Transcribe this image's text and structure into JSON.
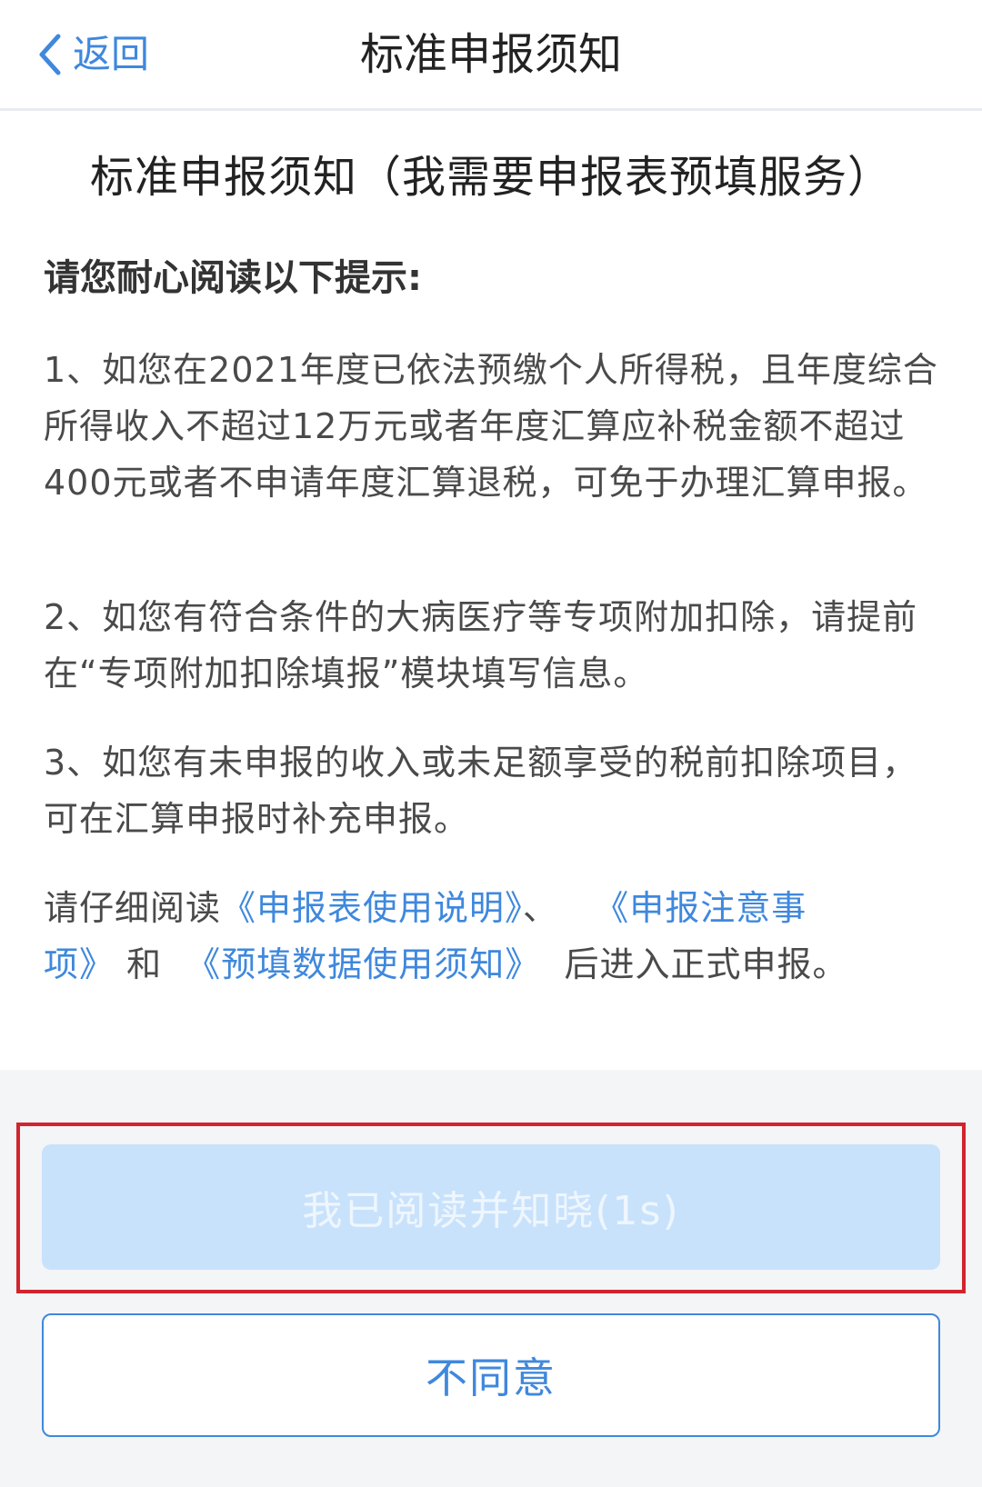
{
  "navbar": {
    "back_label": "返回",
    "title": "标准申报须知"
  },
  "content": {
    "title": "标准申报须知（我需要申报表预填服务）",
    "intro": "请您耐心阅读以下提示:",
    "paragraphs": [
      "1、如您在2021年度已依法预缴个人所得税，且年度综合所得收入不超过12万元或者年度汇算应补税金额不超过400元或者不申请年度汇算退税，可免于办理汇算申报。",
      "2、如您有符合条件的大病医疗等专项附加扣除，请提前在“专项附加扣除填报”模块填写信息。",
      "3、如您有未申报的收入或未足额享受的税前扣除项目，可在汇算申报时补充申报。"
    ],
    "final": {
      "prefix": "请仔细阅读",
      "link1": "《申报表使用说明》",
      "sep1": "、",
      "link2": "《申报注意事项》",
      "sep2": "和",
      "link3": "《预填数据使用须知》",
      "suffix": "后进入正式申报。"
    }
  },
  "actions": {
    "agree_label": "我已阅读并知晓(1s)",
    "disagree_label": "不同意"
  },
  "colors": {
    "accent": "#3f88dd",
    "disabled_button": "#c9e2fb",
    "highlight_border": "#d2242e",
    "footer_bg": "#f4f5f7"
  },
  "icons": {
    "back": "chevron-left-icon"
  }
}
